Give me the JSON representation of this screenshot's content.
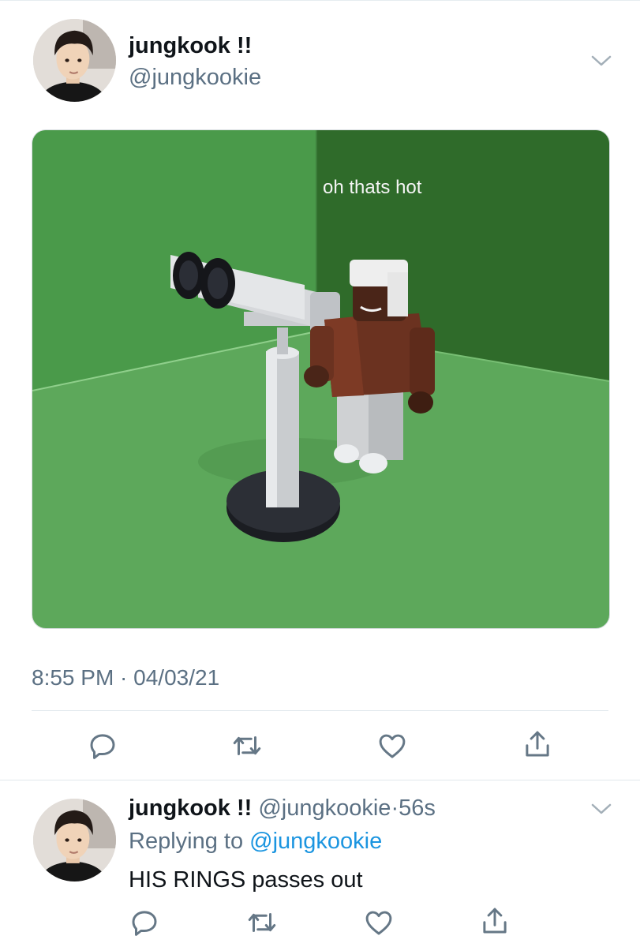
{
  "tweet": {
    "display_name": "jungkook !!",
    "handle": "@jungkookie",
    "image_caption": "oh thats hot",
    "timestamp": "8:55 PM · 04/03/21"
  },
  "actions": [
    "reply-icon",
    "retweet-icon",
    "like-icon",
    "share-icon"
  ],
  "reply": {
    "display_name": "jungkook !!",
    "handle": "@jungkookie",
    "separator": "·",
    "age": "56s",
    "replying_prefix": "Replying to",
    "replying_to": "@jungkookie",
    "text": "HIS RINGS passes out"
  },
  "colors": {
    "secondary_text": "#5b7083",
    "link": "#1b95e0",
    "icon": "#657786"
  }
}
